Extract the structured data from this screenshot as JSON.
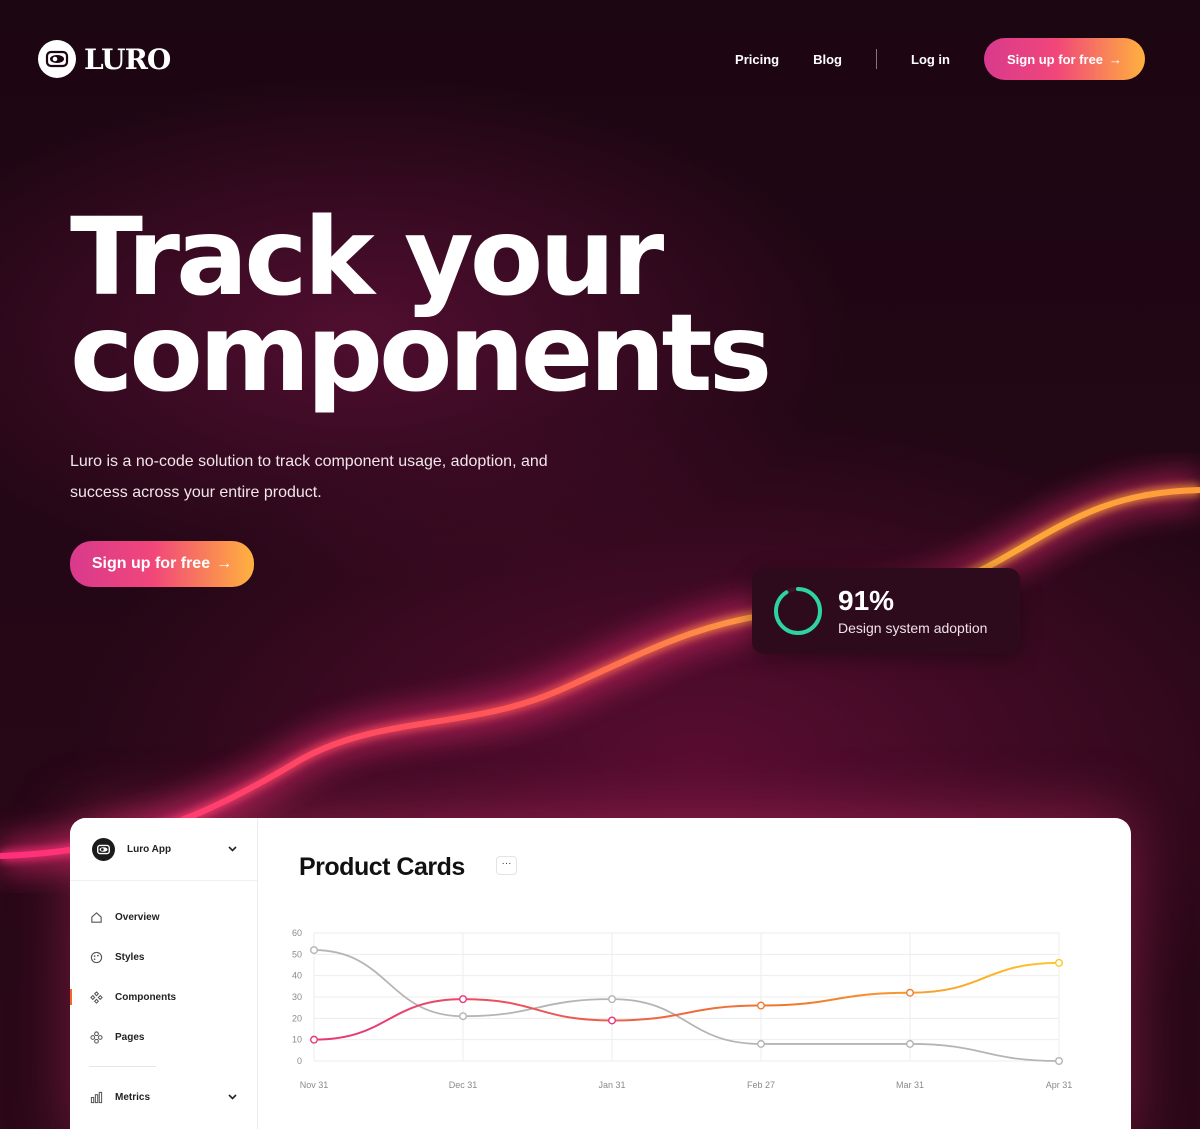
{
  "nav": {
    "brand": "LURO",
    "links": [
      "Pricing",
      "Blog"
    ],
    "login": "Log in",
    "cta": "Sign up for free"
  },
  "hero": {
    "title_line1": "Track your",
    "title_line2": "components",
    "subtitle_line1": "Luro is a no-code solution to track component usage, adoption, and",
    "subtitle_line2": "success across your entire product.",
    "cta": "Sign up for free"
  },
  "stat": {
    "value": "91%",
    "label": "Design system adoption",
    "fraction": 0.91,
    "ring_color": "#2ed3a4"
  },
  "app": {
    "workspace": "Luro App",
    "sidebar": [
      {
        "label": "Overview",
        "icon": "home-icon"
      },
      {
        "label": "Styles",
        "icon": "palette-icon"
      },
      {
        "label": "Components",
        "icon": "components-icon",
        "active": true
      },
      {
        "label": "Pages",
        "icon": "pages-icon"
      }
    ],
    "metrics": {
      "label": "Metrics",
      "icon": "bar-chart-icon"
    },
    "panel_title": "Product Cards",
    "more_label": "···"
  },
  "colors": {
    "accent_pink": "#e8357a",
    "accent_orange": "#f07a2c",
    "accent_yellow": "#ffc72c",
    "gray_series": "#b5b5b5"
  },
  "chart_data": {
    "type": "line",
    "x": [
      "Nov 31",
      "Dec 31",
      "Jan 31",
      "Feb 27",
      "Mar 31",
      "Apr 31"
    ],
    "ylim": [
      0,
      60
    ],
    "yticks": [
      60,
      50,
      40,
      30,
      20,
      10,
      0
    ],
    "series": [
      {
        "values": [
          52,
          21,
          29,
          8,
          8,
          0
        ],
        "color": "#b5b5b5"
      },
      {
        "values": [
          10,
          29,
          19,
          26,
          32,
          46
        ],
        "color": "gradient-pink-orange-yellow"
      }
    ]
  }
}
